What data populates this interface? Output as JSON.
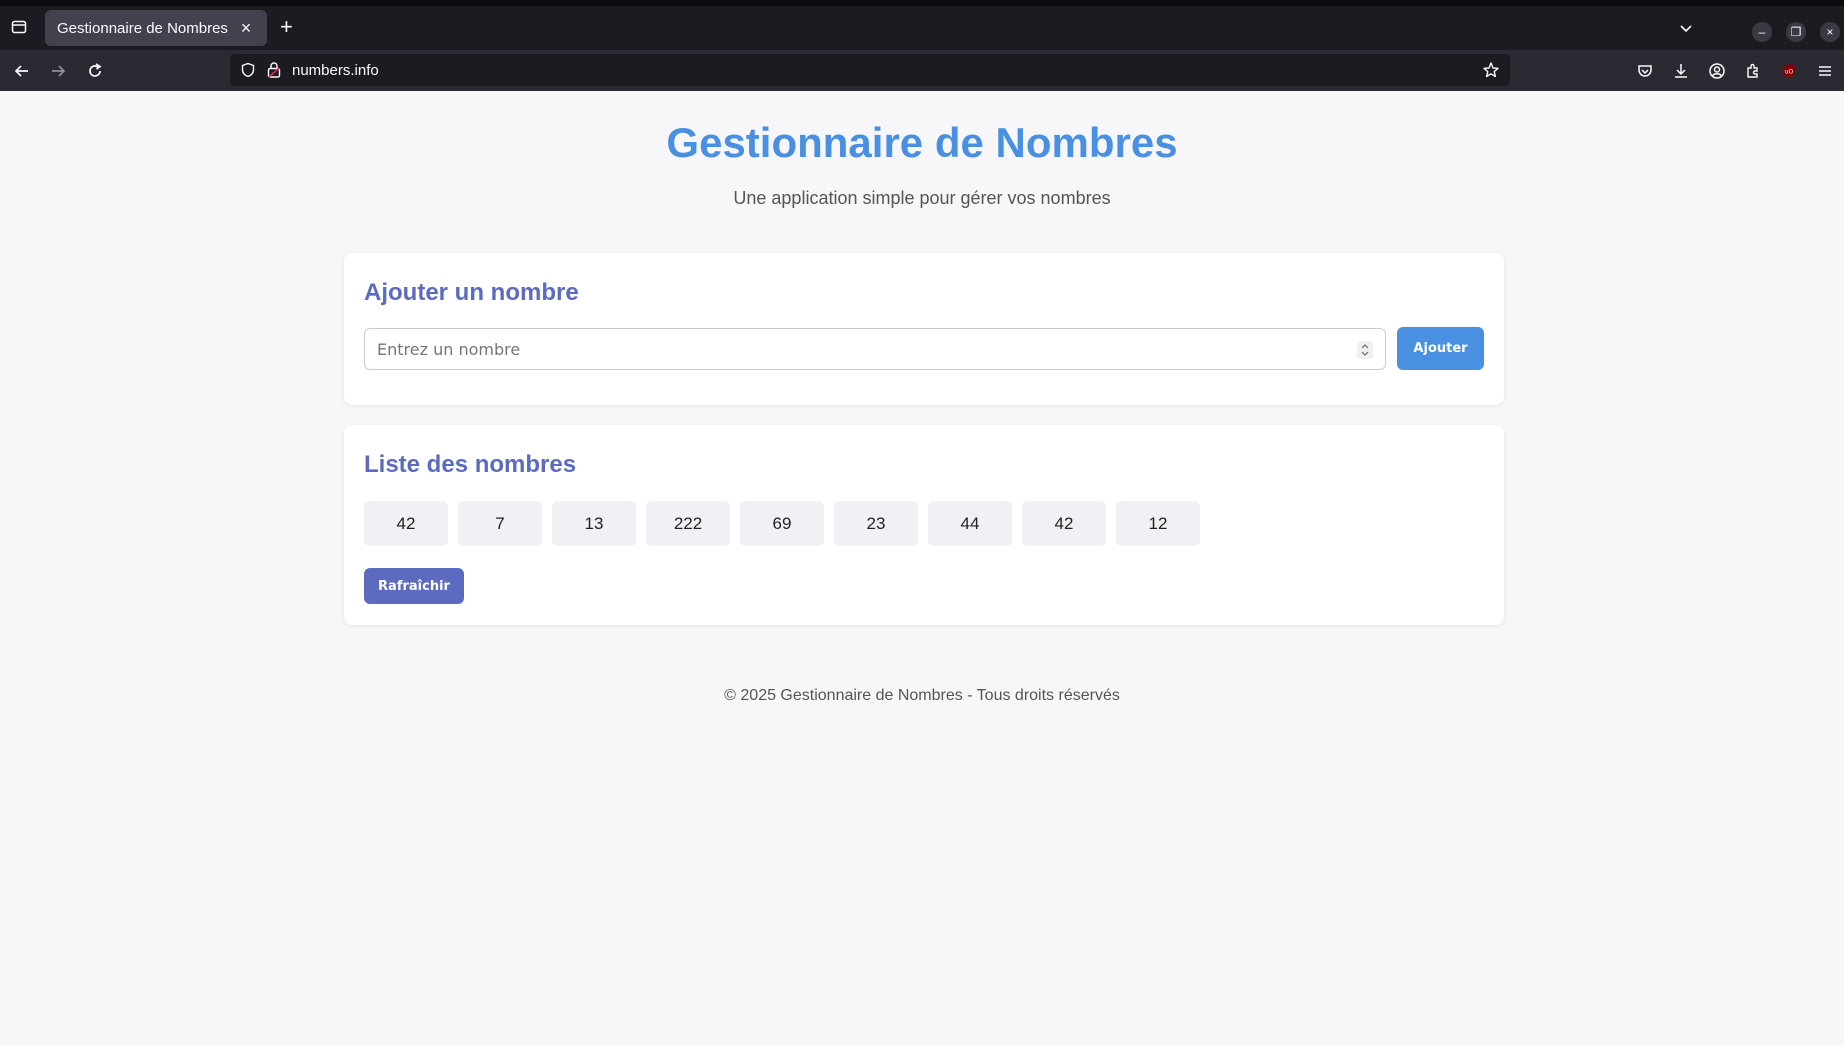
{
  "browser": {
    "tab_title": "Gestionnaire de Nombres",
    "url": "numbers.info"
  },
  "page": {
    "title": "Gestionnaire de Nombres",
    "subtitle": "Une application simple pour gérer vos nombres"
  },
  "add_section": {
    "title": "Ajouter un nombre",
    "input_placeholder": "Entrez un nombre",
    "input_value": "",
    "button_label": "Ajouter"
  },
  "list_section": {
    "title": "Liste des nombres",
    "numbers": [
      "42",
      "7",
      "13",
      "222",
      "69",
      "23",
      "44",
      "42",
      "12"
    ],
    "refresh_label": "Rafraîchir"
  },
  "footer": {
    "text": "© 2025 Gestionnaire de Nombres - Tous droits réservés"
  },
  "colors": {
    "title_blue": "#4a90e2",
    "section_indigo": "#5c6bc0",
    "chip_bg": "#f0f1f4"
  }
}
